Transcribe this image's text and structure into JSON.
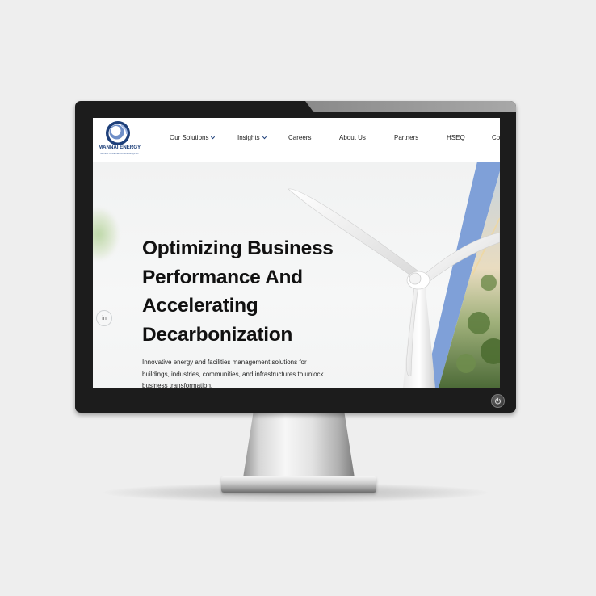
{
  "logo": {
    "name": "MANNAI ENERGY",
    "tagline": "Member of Mannai Corporation QPSC"
  },
  "nav": {
    "items": [
      {
        "label": "Our Solutions",
        "has_dropdown": true
      },
      {
        "label": "Insights",
        "has_dropdown": true
      },
      {
        "label": "Careers",
        "has_dropdown": false
      },
      {
        "label": "About Us",
        "has_dropdown": false
      },
      {
        "label": "Partners",
        "has_dropdown": false
      },
      {
        "label": "HSEQ",
        "has_dropdown": false
      },
      {
        "label": "Co",
        "has_dropdown": false
      }
    ]
  },
  "hero": {
    "title": "Optimizing Business Performance And Accelerating Decarbonization",
    "description": "Innovative energy and facilities management solutions for buildings, industries, communities, and infrastructures to unlock business transformation."
  },
  "social": {
    "linkedin_label": "in"
  },
  "colors": {
    "brand_blue": "#1d3f7a",
    "accent_blue": "#7fa0d8",
    "background": "#eeeeee",
    "bezel": "#1c1c1c"
  },
  "icons": {
    "dropdown": "chevron-down-icon",
    "social": "linkedin-icon",
    "power": "power-icon",
    "logo": "mannai-energy-logo"
  }
}
